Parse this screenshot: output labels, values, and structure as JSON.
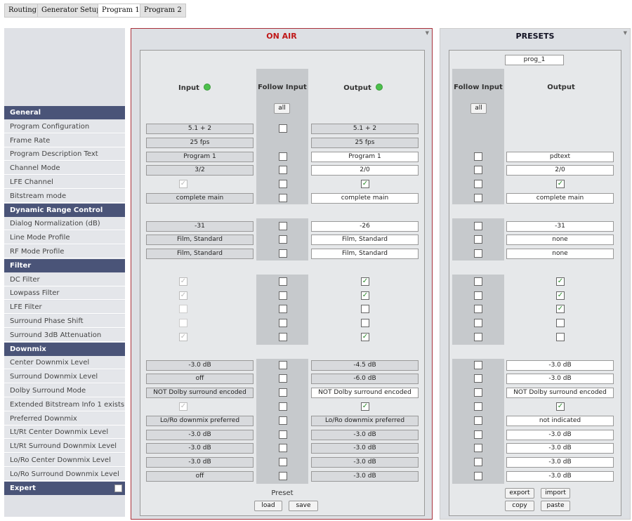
{
  "tabs": [
    "Routing",
    "Generator Setup",
    "Program 1",
    "Program 2"
  ],
  "active_tab": "Program 1",
  "sidebar": {
    "rows": [
      {
        "type": "head",
        "label": "General"
      },
      {
        "type": "item",
        "label": "Program Configuration"
      },
      {
        "type": "item",
        "label": "Frame Rate"
      },
      {
        "type": "item",
        "label": "Program Description Text"
      },
      {
        "type": "item",
        "label": "Channel Mode"
      },
      {
        "type": "item",
        "label": "LFE Channel"
      },
      {
        "type": "item",
        "label": "Bitstream mode"
      },
      {
        "type": "head",
        "label": "Dynamic Range Control"
      },
      {
        "type": "item",
        "label": "Dialog Normalization (dB)"
      },
      {
        "type": "item",
        "label": "Line Mode Profile"
      },
      {
        "type": "item",
        "label": "RF Mode Profile"
      },
      {
        "type": "head",
        "label": "Filter"
      },
      {
        "type": "item",
        "label": "DC Filter"
      },
      {
        "type": "item",
        "label": "Lowpass Filter"
      },
      {
        "type": "item",
        "label": "LFE Filter"
      },
      {
        "type": "item",
        "label": "Surround Phase Shift"
      },
      {
        "type": "item",
        "label": "Surround 3dB Attenuation"
      },
      {
        "type": "head",
        "label": "Downmix"
      },
      {
        "type": "item",
        "label": "Center Downmix Level"
      },
      {
        "type": "item",
        "label": "Surround Downmix Level"
      },
      {
        "type": "item",
        "label": "Dolby Surround Mode"
      },
      {
        "type": "item",
        "label": "Extended Bitstream Info 1 exists"
      },
      {
        "type": "item",
        "label": "Preferred Downmix"
      },
      {
        "type": "item",
        "label": "Lt/Rt Center Downmix Level"
      },
      {
        "type": "item",
        "label": "Lt/Rt Surround Downmix Level"
      },
      {
        "type": "item",
        "label": "Lo/Ro Center Downmix Level"
      },
      {
        "type": "item",
        "label": "Lo/Ro Surround Downmix Level"
      },
      {
        "type": "head",
        "label": "Expert"
      }
    ]
  },
  "onair": {
    "title": "ON AIR",
    "input_header": "Input",
    "follow_header": "Follow Input",
    "output_header": "Output",
    "all_label": "all",
    "preset_label": "Preset",
    "load_label": "load",
    "save_label": "save",
    "rows": [
      {
        "in": "5.1 + 2",
        "in_kind": "gray",
        "follow": "white",
        "out": "5.1 + 2",
        "out_kind": "gray"
      },
      {
        "in": "25 fps",
        "in_kind": "gray",
        "follow": "none",
        "out": "25 fps",
        "out_kind": "gray"
      },
      {
        "in": "Program 1",
        "in_kind": "gray",
        "follow": "box",
        "out": "Program 1",
        "out_kind": "white"
      },
      {
        "in": "3/2",
        "in_kind": "gray",
        "follow": "box",
        "out": "2/0",
        "out_kind": "white"
      },
      {
        "in_check": "faded-checked",
        "follow": "box",
        "out_check": "checked"
      },
      {
        "in": "complete main",
        "in_kind": "gray",
        "follow": "box",
        "out": "complete main",
        "out_kind": "white"
      },
      {
        "gap": true
      },
      {
        "in": "-31",
        "in_kind": "gray",
        "follow": "box",
        "out": "-26",
        "out_kind": "white"
      },
      {
        "in": "Film, Standard",
        "in_kind": "gray",
        "follow": "box",
        "out": "Film, Standard",
        "out_kind": "white"
      },
      {
        "in": "Film, Standard",
        "in_kind": "gray",
        "follow": "box",
        "out": "Film, Standard",
        "out_kind": "white"
      },
      {
        "gap": true
      },
      {
        "in_check": "faded-checked",
        "follow": "box",
        "out_check": "checked"
      },
      {
        "in_check": "faded-checked",
        "follow": "box",
        "out_check": "checked"
      },
      {
        "in_check": "faded-empty",
        "follow": "box",
        "out_check": "empty"
      },
      {
        "in_check": "faded-empty",
        "follow": "box",
        "out_check": "empty"
      },
      {
        "in_check": "faded-checked",
        "follow": "box",
        "out_check": "checked"
      },
      {
        "gap": true
      },
      {
        "in": "-3.0 dB",
        "in_kind": "gray",
        "follow": "box",
        "out": "-4.5 dB",
        "out_kind": "gray"
      },
      {
        "in": "off",
        "in_kind": "gray",
        "follow": "box",
        "out": "-6.0 dB",
        "out_kind": "gray"
      },
      {
        "in": "NOT Dolby surround encoded",
        "in_kind": "gray",
        "follow": "box",
        "out": "NOT Dolby surround encoded",
        "out_kind": "white"
      },
      {
        "in_check": "faded-checked",
        "follow": "box",
        "out_check": "checked"
      },
      {
        "in": "Lo/Ro downmix preferred",
        "in_kind": "gray",
        "follow": "box",
        "out": "Lo/Ro downmix preferred",
        "out_kind": "gray"
      },
      {
        "in": "-3.0 dB",
        "in_kind": "gray",
        "follow": "box",
        "out": "-3.0 dB",
        "out_kind": "gray"
      },
      {
        "in": "-3.0 dB",
        "in_kind": "gray",
        "follow": "box",
        "out": "-3.0 dB",
        "out_kind": "gray"
      },
      {
        "in": "-3.0 dB",
        "in_kind": "gray",
        "follow": "box",
        "out": "-3.0 dB",
        "out_kind": "gray"
      },
      {
        "in": "off",
        "in_kind": "gray",
        "follow": "box",
        "out": "-3.0 dB",
        "out_kind": "gray"
      }
    ]
  },
  "presets": {
    "title": "PRESETS",
    "name_value": "prog_1",
    "follow_header": "Follow Input",
    "output_header": "Output",
    "all_label": "all",
    "export_label": "export",
    "import_label": "import",
    "copy_label": "copy",
    "paste_label": "paste",
    "rows": [
      {
        "follow": "none",
        "out": null
      },
      {
        "follow": "none",
        "out": null
      },
      {
        "follow": "box",
        "out": "pdtext",
        "out_kind": "white"
      },
      {
        "follow": "box",
        "out": "2/0",
        "out_kind": "white"
      },
      {
        "follow": "box",
        "out_check": "checked"
      },
      {
        "follow": "box",
        "out": "complete main",
        "out_kind": "white"
      },
      {
        "gap": true
      },
      {
        "follow": "box",
        "out": "-31",
        "out_kind": "white"
      },
      {
        "follow": "box",
        "out": "none",
        "out_kind": "white"
      },
      {
        "follow": "box",
        "out": "none",
        "out_kind": "white"
      },
      {
        "gap": true
      },
      {
        "follow": "box",
        "out_check": "checked"
      },
      {
        "follow": "box",
        "out_check": "checked"
      },
      {
        "follow": "box",
        "out_check": "checked"
      },
      {
        "follow": "box",
        "out_check": "empty"
      },
      {
        "follow": "box",
        "out_check": "empty"
      },
      {
        "gap": true
      },
      {
        "follow": "box",
        "out": "-3.0 dB",
        "out_kind": "white"
      },
      {
        "follow": "box",
        "out": "-3.0 dB",
        "out_kind": "white"
      },
      {
        "follow": "box",
        "out": "NOT Dolby surround encoded",
        "out_kind": "white"
      },
      {
        "follow": "box",
        "out_check": "checked"
      },
      {
        "follow": "box",
        "out": "not indicated",
        "out_kind": "white"
      },
      {
        "follow": "box",
        "out": "-3.0 dB",
        "out_kind": "white"
      },
      {
        "follow": "box",
        "out": "-3.0 dB",
        "out_kind": "white"
      },
      {
        "follow": "box",
        "out": "-3.0 dB",
        "out_kind": "white"
      },
      {
        "follow": "box",
        "out": "-3.0 dB",
        "out_kind": "white"
      }
    ]
  },
  "colors": {
    "accent_red": "#c01818",
    "header_navy": "#4a5478",
    "led_green": "#4cc04c",
    "check_green": "#2a8a2a"
  }
}
